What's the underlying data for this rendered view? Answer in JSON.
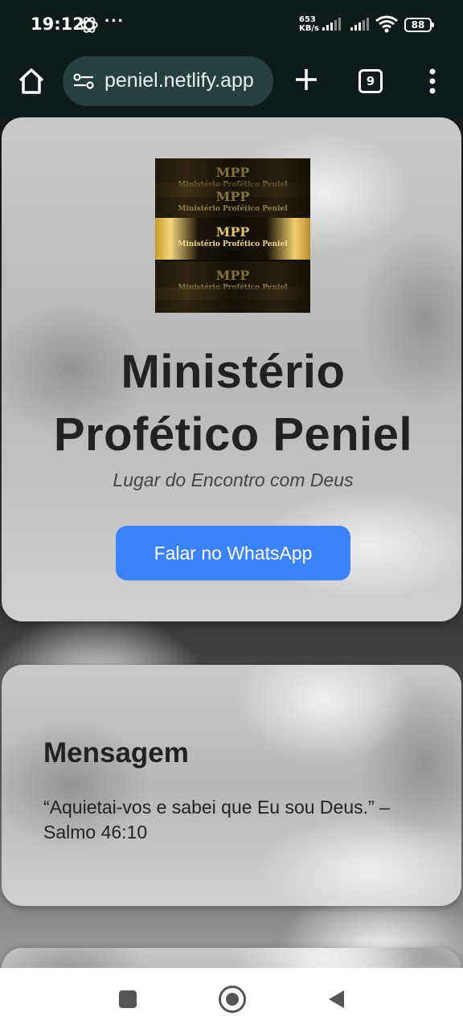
{
  "status_bar": {
    "time": "19:12",
    "notification_dots": "···",
    "network_speed_value": "653",
    "network_speed_unit": "KB/s",
    "battery": "88",
    "icons": [
      "openai-app-icon",
      "signal-icon",
      "signal-icon",
      "wifi-icon",
      "battery-icon"
    ]
  },
  "browser": {
    "url": "peniel.netlify.app",
    "tab_count": "9",
    "icons": [
      "home-icon",
      "site-settings-icon",
      "plus-icon",
      "tabs-icon",
      "more-vert-icon"
    ]
  },
  "hero": {
    "logo": {
      "monogram": "MPP",
      "name": "Ministério Profético Peniel"
    },
    "title_line1": "Ministério",
    "title_line2": "Profético Peniel",
    "subtitle": "Lugar do Encontro com Deus",
    "whatsapp_button": "Falar no WhatsApp",
    "button_color": "#3b82f6"
  },
  "message": {
    "title": "Mensagem",
    "text": "“Aquietai-vos e sabei que Eu sou Deus.” – Salmo 46:10"
  },
  "navigation_bar": {
    "icons": [
      "recent-apps-icon",
      "home-circle-icon",
      "back-icon"
    ]
  }
}
